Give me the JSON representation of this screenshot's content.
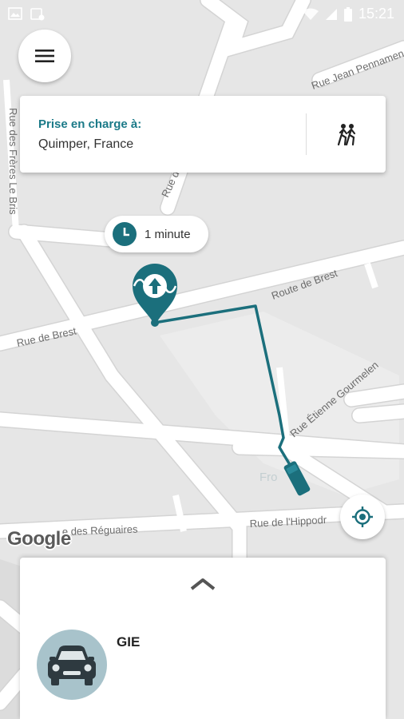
{
  "status_bar": {
    "time": "15:21",
    "icons": [
      "image-icon",
      "notification-icon",
      "wifi-icon",
      "signal-icon",
      "battery-icon"
    ]
  },
  "map": {
    "streets": {
      "rue_de_brest": "Rue de Brest",
      "route_de_brest": "Route de Brest",
      "rue_etienne_gourmelen": "Rue Étienne Gourmelen",
      "rue_de_lhippodrome": "Rue de l'Hippodr",
      "rue_des_reguaires": "e des Réguaires",
      "rue_jean_pennamen": "Rue Jean Pennamen",
      "rue_de_kerogan": "Rue de Kerogan",
      "rue_jean_bourriou": "Rue Jean",
      "left_vertical": "Rue des Frères Le Bris"
    },
    "poi_label": "Fro",
    "google_logo": "Google",
    "route_color": "#1b6f7c",
    "pin_color": "#1b6f7c"
  },
  "pickup": {
    "label": "Prise en charge à:",
    "address": "Quimper, France"
  },
  "eta": {
    "text": "1 minute"
  },
  "vehicle": {
    "driver_name": "GIE",
    "avatar_bg": "#a8c3cb"
  },
  "colors": {
    "accent": "#1b7a88",
    "map_bg": "#e6e6e6",
    "road": "#ffffff"
  }
}
